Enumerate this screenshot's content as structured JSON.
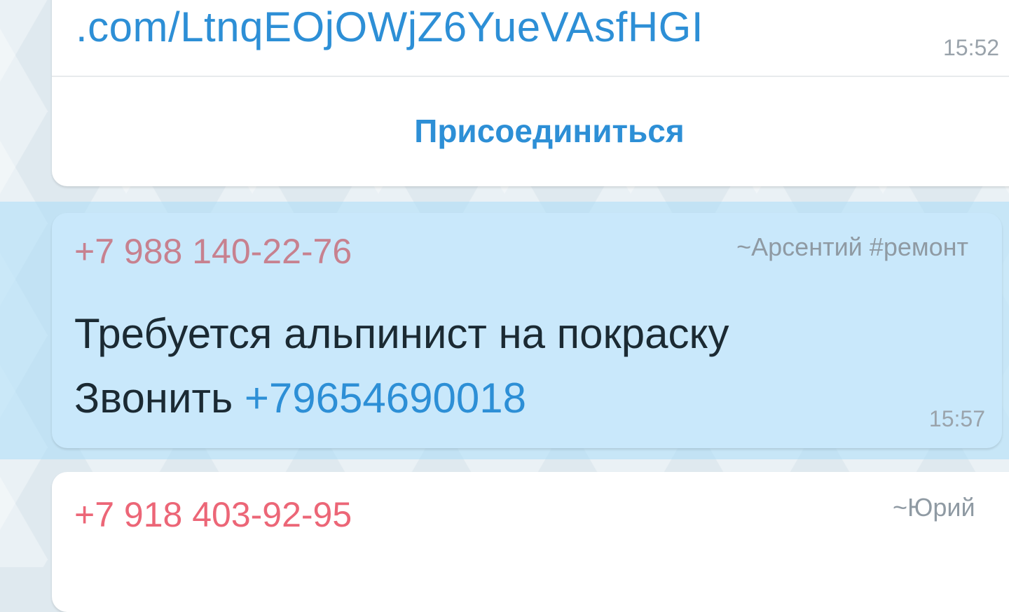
{
  "messages": [
    {
      "link_text": ".com/LtnqEOjOWjZ6YueVAsfHGI",
      "time": "15:52",
      "button_label": "Присоединиться"
    },
    {
      "sender_phone": "+7 988 140-22-76",
      "sender_name": "~Арсентий #ремонт",
      "line1": "Требуется альпинист на покраску",
      "line2_prefix": "Звонить ",
      "line2_phone": "+79654690018",
      "time": "15:57"
    },
    {
      "sender_phone": "+7 918 403-92-95",
      "sender_name": "~Юрий"
    }
  ],
  "colors": {
    "link": "#2d8fd6",
    "sender1": "#c7818f",
    "sender2": "#ec6677",
    "highlight": "#c9e8fb"
  }
}
